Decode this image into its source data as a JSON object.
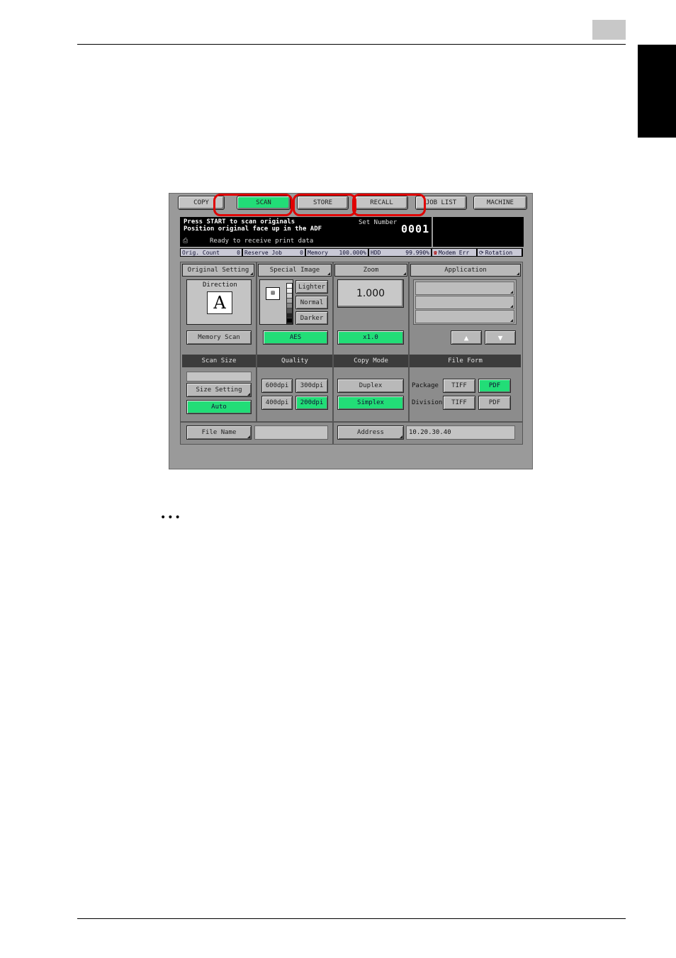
{
  "tabs": [
    {
      "label": "COPY",
      "active": false
    },
    {
      "label": "SCAN",
      "active": true
    },
    {
      "label": "STORE",
      "active": false
    },
    {
      "label": "RECALL",
      "active": false
    },
    {
      "label": "JOB LIST",
      "active": false
    },
    {
      "label": "MACHINE",
      "active": false
    }
  ],
  "message": {
    "line1": "Press START to scan originals",
    "line2": "Position original face up in the ADF",
    "line3": "Ready to receive print data",
    "set_number_label": "Set Number",
    "set_number": "0001"
  },
  "status": {
    "orig_count_label": "Orig. Count",
    "orig_count": "0",
    "reserve_job_label": "Reserve Job",
    "reserve_job": "0",
    "memory_label": "Memory",
    "memory": "100.000%",
    "hdd_label": "HDD",
    "hdd": "99.990%",
    "modem": "Modem Err",
    "rotation": "Rotation"
  },
  "sections": {
    "original_setting": "Original Setting",
    "special_image": "Special Image",
    "zoom": "Zoom",
    "application": "Application",
    "scan_size": "Scan Size",
    "quality": "Quality",
    "copy_mode": "Copy Mode",
    "file_form": "File Form"
  },
  "original": {
    "direction_label": "Direction",
    "direction_glyph": "A",
    "memory_scan": "Memory Scan"
  },
  "density": {
    "lighter": "Lighter",
    "normal": "Normal",
    "darker": "Darker",
    "aes": "AES"
  },
  "zoom": {
    "value": "1.000",
    "x1": "x1.0"
  },
  "scan_size": {
    "size_setting": "Size Setting",
    "auto": "Auto"
  },
  "quality": {
    "q600": "600dpi",
    "q300": "300dpi",
    "q400": "400dpi",
    "q200": "200dpi"
  },
  "copy_mode": {
    "duplex": "Duplex",
    "simplex": "Simplex"
  },
  "file_form": {
    "package_label": "Package",
    "division_label": "Division",
    "tiff": "TIFF",
    "pdf": "PDF"
  },
  "bottom": {
    "file_name": "File Name",
    "file_name_value": "",
    "address": "Address",
    "address_value": "10.20.30.40"
  },
  "arrows": {
    "up": "▲",
    "down": "▼"
  },
  "doc": {
    "dots": "•••"
  },
  "colors": {
    "active_green": "#22dd77",
    "highlight_red": "#e00000"
  }
}
